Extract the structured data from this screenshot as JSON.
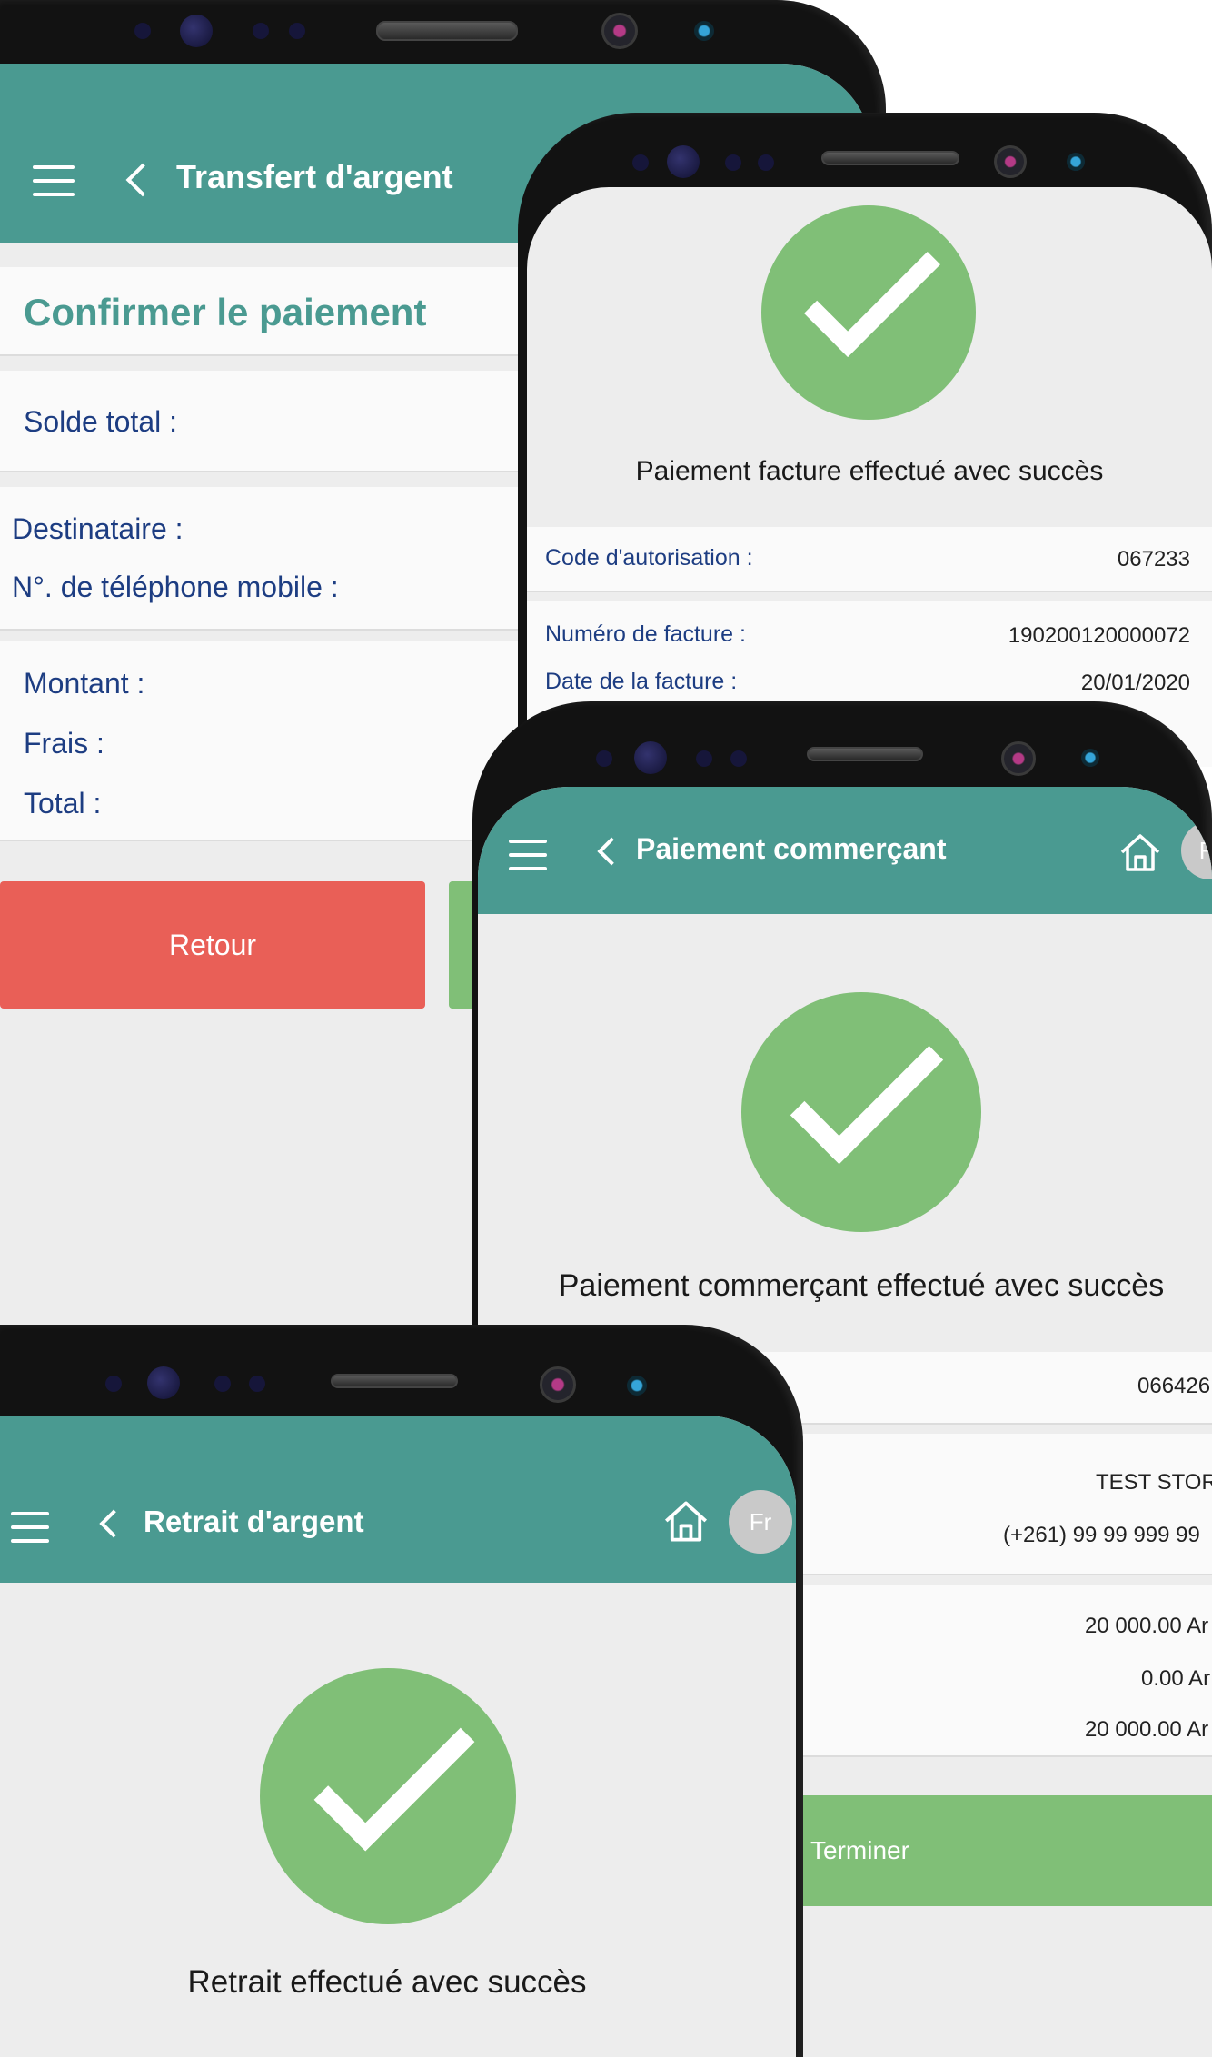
{
  "transfer_screen": {
    "title": "Transfert d'argent",
    "heading": "Confirmer le paiement",
    "solde_label": "Solde total :",
    "destinataire_label": "Destinataire :",
    "phone_label": "N°. de téléphone mobile :",
    "montant_label": "Montant :",
    "frais_label": "Frais :",
    "total_label": "Total :",
    "retour_button": "Retour"
  },
  "bill_screen": {
    "message": "Paiement facture effectué avec succès",
    "auth_label": "Code d'autorisation :",
    "auth_value": "067233",
    "invoice_number_label": "Numéro de facture :",
    "invoice_number_value": "190200120000072",
    "invoice_date_label": "Date de la facture :",
    "invoice_date_value": "20/01/2020"
  },
  "merchant_screen": {
    "title": "Paiement commerçant",
    "lang": "Fr",
    "message": "Paiement commerçant effectué avec succès",
    "code_value": "066426",
    "store_name": "TEST STORE",
    "store_phone": "(+261) 99 99 999 99",
    "amount": "20 000.00 Ar",
    "fees": "0.00 Ar",
    "total": "20 000.00 Ar",
    "terminer_button": "Terminer"
  },
  "withdraw_screen": {
    "title": "Retrait d'argent",
    "lang": "Fr",
    "message": "Retrait effectué avec succès"
  },
  "colors": {
    "header_teal": "#4a9a91",
    "success_green": "#80bf77",
    "retour_red": "#e95f57",
    "label_blue": "#1d3d82"
  }
}
